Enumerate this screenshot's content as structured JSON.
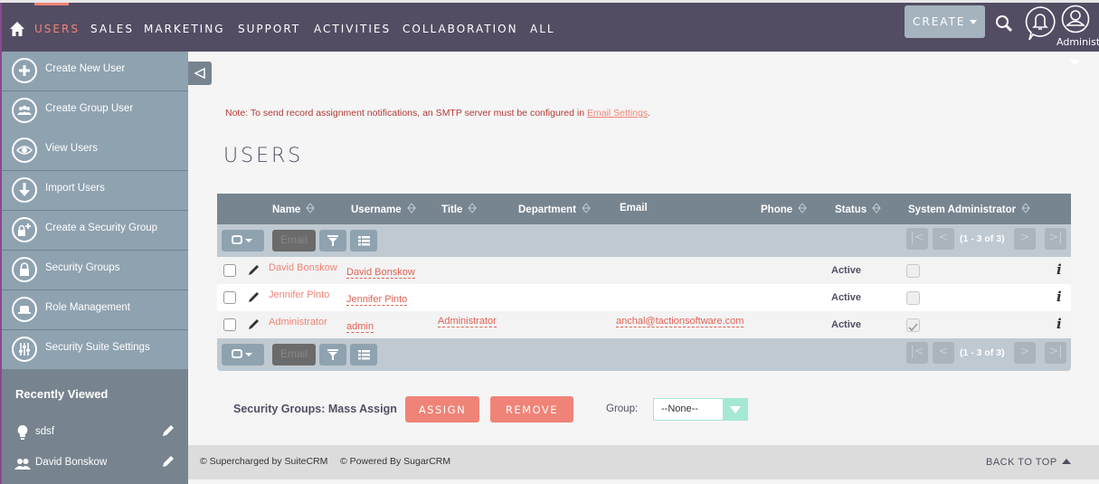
{
  "navbar": {
    "items": [
      "USERS",
      "SALES",
      "MARKETING",
      "SUPPORT",
      "ACTIVITIES",
      "COLLABORATION",
      "ALL"
    ],
    "active": "USERS",
    "create_label": "CREATE",
    "user_label": "Administ",
    "icons": [
      "home-icon",
      "search-icon",
      "bell-icon",
      "user-icon"
    ]
  },
  "sidebar": {
    "items": [
      {
        "label": "Create New User",
        "icon": "plus-icon"
      },
      {
        "label": "Create Group User",
        "icon": "group-icon"
      },
      {
        "label": "View Users",
        "icon": "eye-icon"
      },
      {
        "label": "Import Users",
        "icon": "download-arrow-icon"
      },
      {
        "label": "Create a Security Group",
        "icon": "lock-plus-icon"
      },
      {
        "label": "Security Groups",
        "icon": "lock-icon"
      },
      {
        "label": "Role Management",
        "icon": "hat-icon"
      },
      {
        "label": "Security Suite Settings",
        "icon": "sliders-icon"
      }
    ],
    "recently_viewed_title": "Recently Viewed",
    "recent": [
      {
        "label": "sdsf",
        "icon": "lightbulb-icon"
      },
      {
        "label": "David Bonskow",
        "icon": "users-icon"
      }
    ]
  },
  "main": {
    "note_text": "Note: To send record assignment notifications, an SMTP server must be configured in ",
    "note_link": "Email Settings",
    "note_end": ".",
    "title": "USERS",
    "table": {
      "columns": [
        "Name",
        "Username",
        "Title",
        "Department",
        "Email",
        "Phone",
        "Status",
        "System Administrator"
      ],
      "email_button": "Email",
      "pagination": "(1 - 3 of 3)",
      "rows": [
        {
          "name": "David Bonskow",
          "username": "David Bonskow",
          "title": "",
          "department": "",
          "email": "",
          "phone": "",
          "status": "Active",
          "is_admin": false
        },
        {
          "name": "Jennifer Pinto",
          "username": "Jennifer Pinto",
          "title": "",
          "department": "",
          "email": "",
          "phone": "",
          "status": "Active",
          "is_admin": false
        },
        {
          "name": "Administrator",
          "username": "admin",
          "title": "Administrator",
          "department": "",
          "email": "anchal@tactionsoftware.com",
          "phone": "",
          "status": "Active",
          "is_admin": true
        }
      ]
    },
    "mass_assign": {
      "label": "Security Groups: Mass Assign",
      "assign": "ASSIGN",
      "remove": "REMOVE",
      "group_label": "Group:",
      "group_value": "--None--"
    }
  },
  "footer": {
    "supercharged": "© Supercharged by SuiteCRM",
    "powered": "© Powered By SugarCRM",
    "back_to_top": "BACK TO TOP"
  },
  "colors": {
    "navbar": "#534d64",
    "accent": "#f08377",
    "sidebar": "#8fa2b0",
    "table_header": "#778591"
  }
}
